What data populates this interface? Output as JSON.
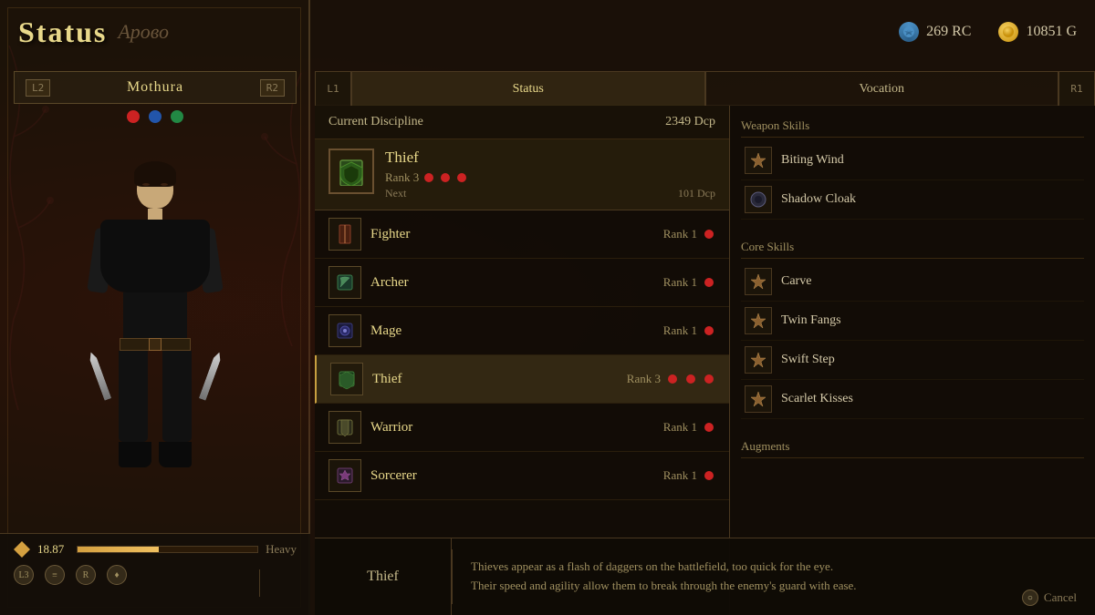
{
  "header": {
    "title": "Status",
    "subtitle": "Арово",
    "rc_amount": "269 RC",
    "gold_amount": "10851 G"
  },
  "left_panel": {
    "nav_left": "L2",
    "nav_right": "R2",
    "character_name": "Mothura",
    "icons": [
      "red",
      "blue",
      "green"
    ],
    "weight_value": "18.87",
    "weight_label": "Heavy",
    "bottom_nav": [
      "L3",
      "≡",
      "R",
      "♦"
    ]
  },
  "tabs": {
    "left_trigger": "L1",
    "right_trigger": "R1",
    "items": [
      {
        "id": "status",
        "label": "Status",
        "active": true
      },
      {
        "id": "vocation",
        "label": "Vocation",
        "active": false
      }
    ]
  },
  "disciplines": {
    "header_label": "Current Discipline",
    "header_value": "2349 Dcp",
    "active": {
      "name": "Thief",
      "rank_label": "Rank 3",
      "rank_dots": 3,
      "max_dots": 3,
      "next_label": "Next",
      "next_value": "101 Dcp",
      "icon": "🛡"
    },
    "list": [
      {
        "name": "Fighter",
        "rank": 1,
        "rank_dots": 1,
        "icon": "⚔"
      },
      {
        "name": "Archer",
        "rank": 1,
        "rank_dots": 1,
        "icon": "🏹"
      },
      {
        "name": "Mage",
        "rank": 1,
        "rank_dots": 1,
        "icon": "🔮"
      },
      {
        "name": "Thief",
        "rank": 3,
        "rank_dots": 3,
        "icon": "🗡",
        "selected": true
      },
      {
        "name": "Warrior",
        "rank": 1,
        "rank_dots": 1,
        "icon": "🛡"
      },
      {
        "name": "Sorcerer",
        "rank": 1,
        "rank_dots": 1,
        "icon": "✨"
      }
    ]
  },
  "skills": {
    "weapon_skills_title": "Weapon Skills",
    "weapon_skills": [
      {
        "name": "Biting Wind",
        "icon": "⚔"
      },
      {
        "name": "Shadow Cloak",
        "icon": "🌑"
      }
    ],
    "core_skills_title": "Core Skills",
    "core_skills": [
      {
        "name": "Carve",
        "icon": "⚔"
      },
      {
        "name": "Twin Fangs",
        "icon": "⚔"
      },
      {
        "name": "Swift Step",
        "icon": "⚔"
      },
      {
        "name": "Scarlet Kisses",
        "icon": "⚔"
      }
    ],
    "augments_title": "Augments"
  },
  "info_bar": {
    "vocation_name": "Thief",
    "description_line1": "Thieves appear as a flash of daggers on the battlefield, too quick for the eye.",
    "description_line2": "Their speed and agility allow them to break through the enemy's guard with ease."
  },
  "cancel_button": {
    "label": "Cancel",
    "shortcut": "○"
  }
}
